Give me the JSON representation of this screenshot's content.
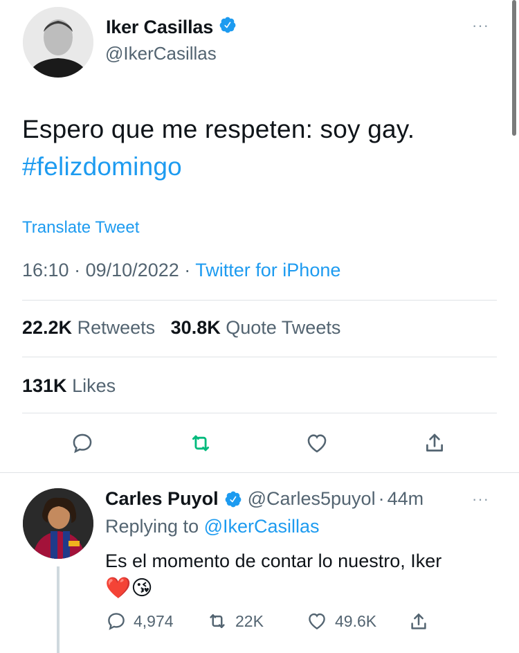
{
  "tweet": {
    "author_name": "Iker Casillas",
    "author_handle": "@IkerCasillas",
    "verified_icon": "verified-badge-icon",
    "text": "Espero que me respeten: soy gay.",
    "hashtag": "#felizdomingo",
    "translate_label": "Translate Tweet",
    "time": "16:10",
    "date": "09/10/2022",
    "separator": "·",
    "source": "Twitter for iPhone",
    "retweets_count": "22.2K",
    "retweets_label": "Retweets",
    "quote_count": "30.8K",
    "quote_label": "Quote Tweets",
    "likes_count": "131K",
    "likes_label": "Likes",
    "more_label": "···"
  },
  "reply": {
    "author_name": "Carles Puyol",
    "author_handle": "@Carles5puyol",
    "separator": "·",
    "age": "44m",
    "replying_prefix": "Replying to",
    "replying_to": "@IkerCasillas",
    "text": "Es el momento de contar lo nuestro, Iker",
    "emojis": "❤️😘",
    "reply_count": "4,974",
    "retweet_count": "22K",
    "like_count": "49.6K",
    "more_label": "···"
  },
  "colors": {
    "link": "#1d9bf0",
    "retweet_green": "#00ba7c",
    "muted": "#536471",
    "text": "#0f1419"
  }
}
